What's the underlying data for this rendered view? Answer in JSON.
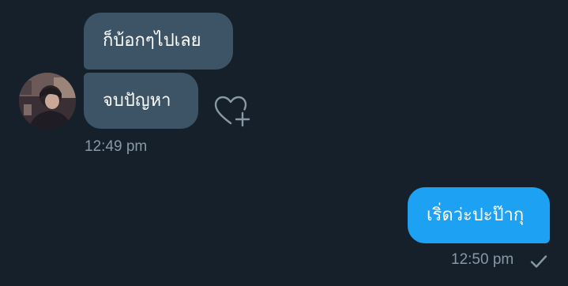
{
  "conversation": {
    "messages": [
      {
        "direction": "received",
        "text": "ก็บ้อกๆไปเลย"
      },
      {
        "direction": "received",
        "text": "จบปัญหา"
      },
      {
        "direction": "sent",
        "text": "เริ่ดว่ะปะป๊ากุ"
      }
    ],
    "received_timestamp": "12:49 pm",
    "sent_timestamp": "12:50 pm"
  },
  "icons": {
    "add_reaction": "heart-plus-icon",
    "delivered": "checkmark-icon"
  },
  "colors": {
    "background": "#15202b",
    "received_bubble": "#3d5466",
    "sent_bubble": "#1da1f2",
    "timestamp_text": "#8899a6"
  }
}
